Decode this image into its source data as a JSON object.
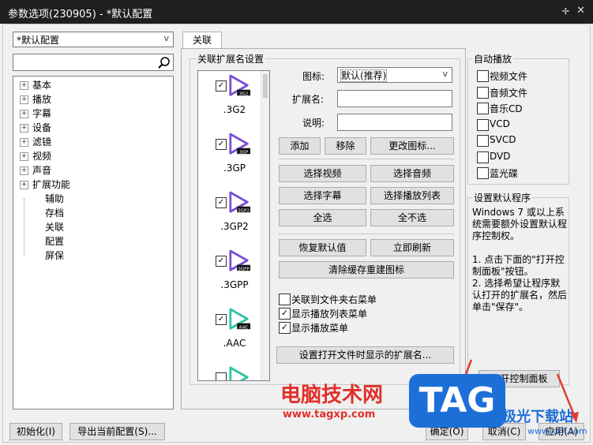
{
  "window": {
    "title": "参数选项(230905) - *默认配置",
    "pin_icon": "pin-icon",
    "close_icon": "close-icon"
  },
  "sidebar": {
    "profile_select": "*默认配置",
    "search_placeholder": "",
    "tree": [
      {
        "label": "基本",
        "expandable": true
      },
      {
        "label": "播放",
        "expandable": true
      },
      {
        "label": "字幕",
        "expandable": true
      },
      {
        "label": "设备",
        "expandable": true
      },
      {
        "label": "滤镜",
        "expandable": true
      },
      {
        "label": "视频",
        "expandable": true
      },
      {
        "label": "声音",
        "expandable": true
      },
      {
        "label": "扩展功能",
        "expandable": true
      },
      {
        "label": "辅助",
        "expandable": false
      },
      {
        "label": "存档",
        "expandable": false
      },
      {
        "label": "关联",
        "expandable": false
      },
      {
        "label": "配置",
        "expandable": false
      },
      {
        "label": "屏保",
        "expandable": false
      }
    ]
  },
  "tab": {
    "label": "关联"
  },
  "ext_group": {
    "label": "关联扩展名设置",
    "items": [
      {
        "name": ".3G2",
        "badge": "3G2",
        "checked": true,
        "color": "#7b4fd6"
      },
      {
        "name": ".3GP",
        "badge": "3GP",
        "checked": true,
        "color": "#7b4fd6"
      },
      {
        "name": ".3GP2",
        "badge": "3GP2",
        "checked": true,
        "color": "#7b4fd6"
      },
      {
        "name": ".3GPP",
        "badge": "3GPP",
        "checked": true,
        "color": "#7b4fd6"
      },
      {
        "name": ".AAC",
        "badge": "AAC",
        "checked": true,
        "color": "#2fc4a6"
      },
      {
        "name": "",
        "badge": "",
        "checked": false,
        "color": "#2fc4a6"
      }
    ]
  },
  "form": {
    "icon_label": "图标:",
    "icon_value": "默认(推荐)",
    "ext_label": "扩展名:",
    "desc_label": "说明:",
    "add": "添加",
    "remove": "移除",
    "change_icon": "更改图标...",
    "select_video": "选择视频",
    "select_audio": "选择音频",
    "select_subtitle": "选择字幕",
    "select_playlist": "选择播放列表",
    "select_all": "全选",
    "select_none": "全不选",
    "restore_default": "恢复默认值",
    "refresh_now": "立即刷新",
    "clear_cache": "清除缓存重建图标",
    "cb_folder_menu": "关联到文件夹右菜单",
    "cb_show_playlist_menu": "显示播放列表菜单",
    "cb_show_play_menu": "显示播放菜单",
    "cb_folder_checked": false,
    "cb_playlist_checked": true,
    "cb_play_checked": true,
    "set_open_ext": "设置打开文件时显示的扩展名..."
  },
  "autoplay": {
    "label": "自动播放",
    "items": [
      "视频文件",
      "音频文件",
      "音乐CD",
      "VCD",
      "SVCD",
      "DVD",
      "蓝光碟"
    ]
  },
  "default_program": {
    "label": "设置默认程序",
    "text": "Windows 7 或以上系统需要额外设置默认程序控制权。\n\n1. 点击下面的\"打开控制面板\"按钮。\n2. 选择希望让程序默认打开的扩展名，然后单击\"保存\"。",
    "open_panel": "打开控制面板"
  },
  "footer": {
    "init": "初始化(I)",
    "export": "导出当前配置(S)...",
    "ok": "确定(O)",
    "cancel": "取消(C)",
    "apply": "应用(A)"
  },
  "watermark": {
    "brand": "电脑技术网",
    "url": "www.tagxp.com",
    "tag": "TAG",
    "site2": "极光下载站",
    "site2_url": "www.xz7.com"
  },
  "colors": {
    "accent": "#1d6fd8",
    "watermark_red": "#e0302a",
    "arrow_red": "#e23c32"
  }
}
